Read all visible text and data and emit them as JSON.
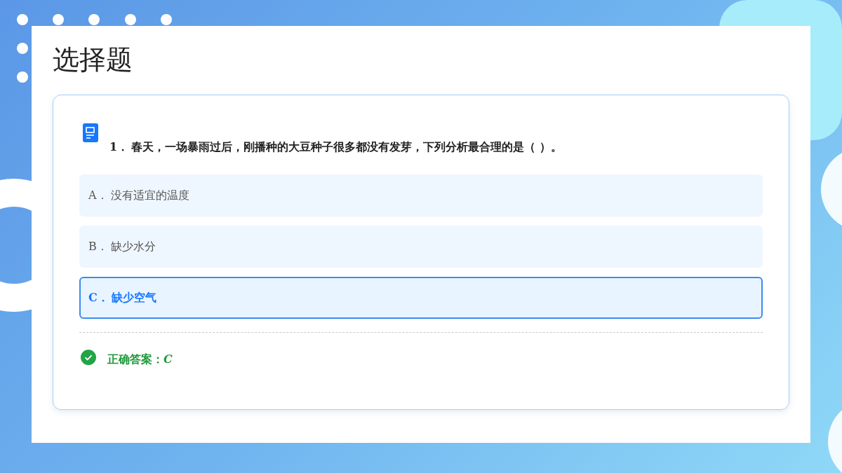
{
  "title": "选择题",
  "question": {
    "number": "1．",
    "text": "春天，一场暴雨过后，刚播种的大豆种子很多都没有发芽，下列分析最合理的是（ ）。"
  },
  "options": [
    {
      "letter": "A．",
      "text": "没有适宜的温度",
      "selected": false
    },
    {
      "letter": "B．",
      "text": "缺少水分",
      "selected": false
    },
    {
      "letter": "C．",
      "text": "缺少空气",
      "selected": true
    }
  ],
  "answer": {
    "label": "正确答案：",
    "value": "C"
  }
}
